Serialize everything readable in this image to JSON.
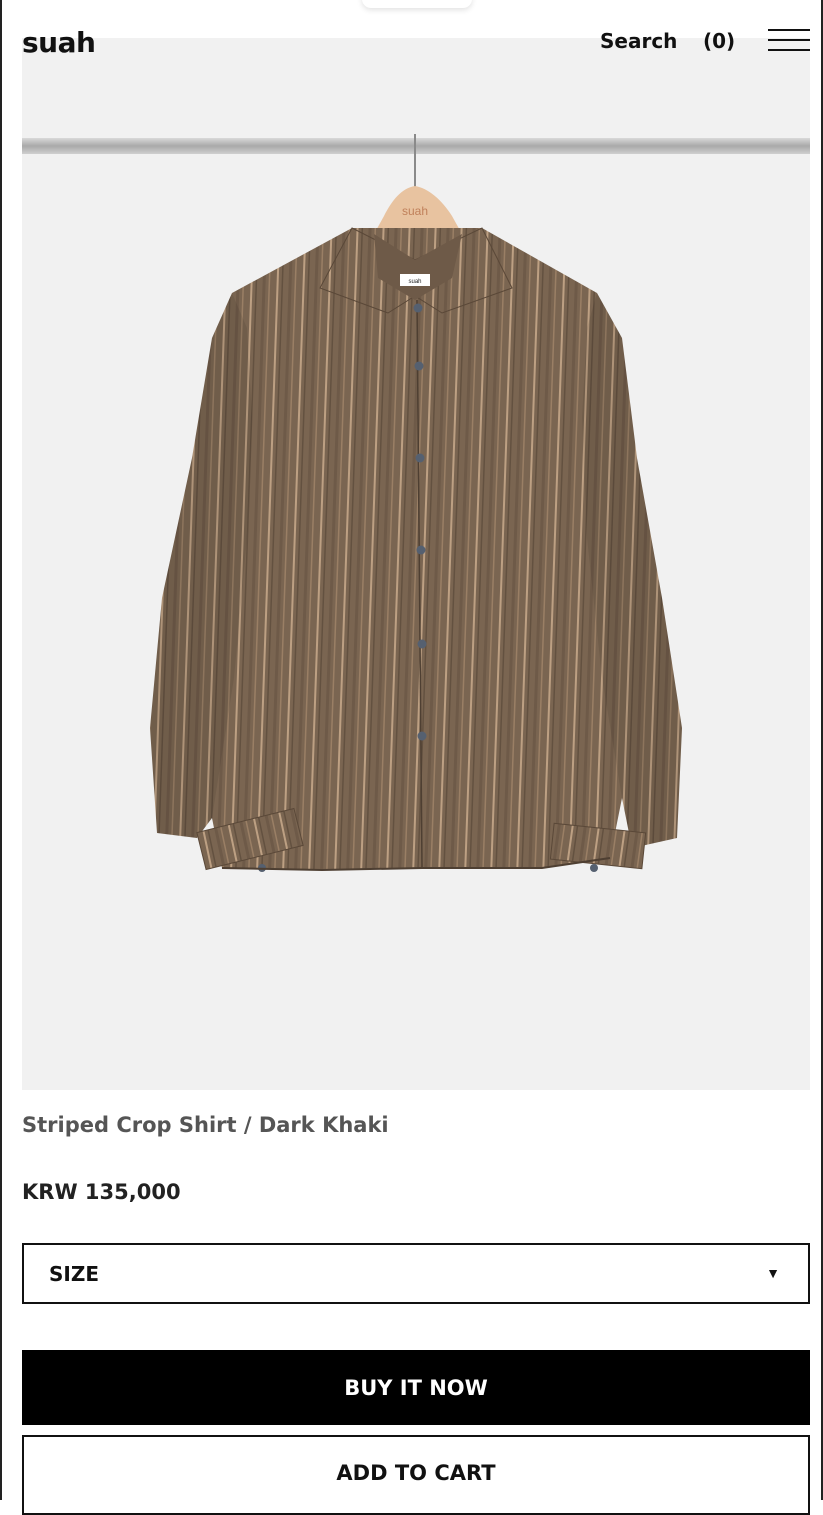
{
  "header": {
    "logo": "suah",
    "search_label": "Search",
    "cart_count": "(0)",
    "menu_icon": "hamburger-menu-icon"
  },
  "product": {
    "image": {
      "hanger_brand": "suah",
      "collar_label": "suah",
      "background_color": "#f1f1f1",
      "shirt_color": "#7a6551",
      "stripe_color": "#c9ab8c",
      "hanger_color": "#e8c3a0"
    },
    "name": "Striped Crop Shirt / Dark Khaki",
    "price": "KRW 135,000"
  },
  "options": {
    "size_label": "SIZE",
    "size_arrow_icon": "caret-down-icon"
  },
  "actions": {
    "buy_now": "BUY IT NOW",
    "add_to_cart": "ADD TO CART"
  }
}
